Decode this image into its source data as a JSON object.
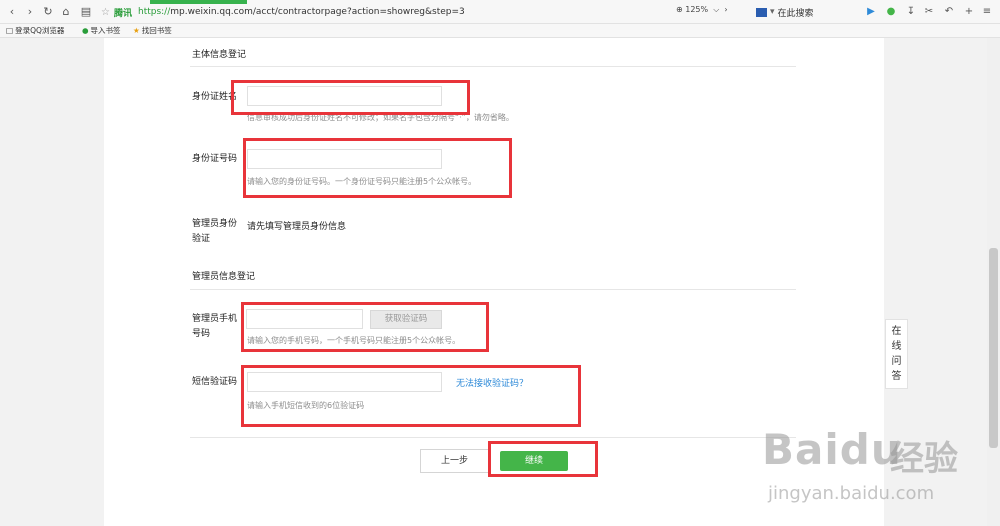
{
  "browser": {
    "address": {
      "secure_label": "腾讯",
      "url_scheme": "https://",
      "url_rest": "mp.weixin.qq.com/acct/contractorpage?action=showreg&step=3"
    },
    "zoom_level": "125%",
    "search_placeholder": "在此搜索",
    "bookmarks": [
      {
        "label": "登录QQ浏览器"
      },
      {
        "label": "导入书签"
      },
      {
        "label": "找回书签"
      }
    ]
  },
  "form": {
    "subject_section_title": "主体信息登记",
    "id_name": {
      "label": "身份证姓名",
      "value": "",
      "hint": "信息审核成功后身份证姓名不可修改；如果名字包含分隔号“·”，请勿省略。"
    },
    "id_number": {
      "label": "身份证号码",
      "value": "",
      "hint": "请输入您的身份证号码。一个身份证号码只能注册5个公众帐号。"
    },
    "admin_verify": {
      "label_line1": "管理员身份",
      "label_line2": "验证",
      "value": "请先填写管理员身份信息"
    },
    "admin_section_title": "管理员信息登记",
    "admin_phone": {
      "label_line1": "管理员手机",
      "label_line2": "号码",
      "value": "",
      "get_code_button": "获取验证码",
      "hint": "请输入您的手机号码，一个手机号码只能注册5个公众帐号。"
    },
    "sms_code": {
      "label": "短信验证码",
      "value": "",
      "cannot_receive_link": "无法接收验证码？",
      "hint": "请输入手机短信收到的6位验证码"
    },
    "prev_button": "上一步",
    "next_button": "继续"
  },
  "help_float": {
    "chars": [
      "在",
      "线",
      "问",
      "答"
    ]
  },
  "watermark": {
    "logo": "Baidu",
    "cn": "经验",
    "url": "jingyan.baidu.com"
  },
  "colors": {
    "accent_green": "#44b549",
    "annotation_red": "#e8343a",
    "link_blue": "#2e8ad8"
  }
}
